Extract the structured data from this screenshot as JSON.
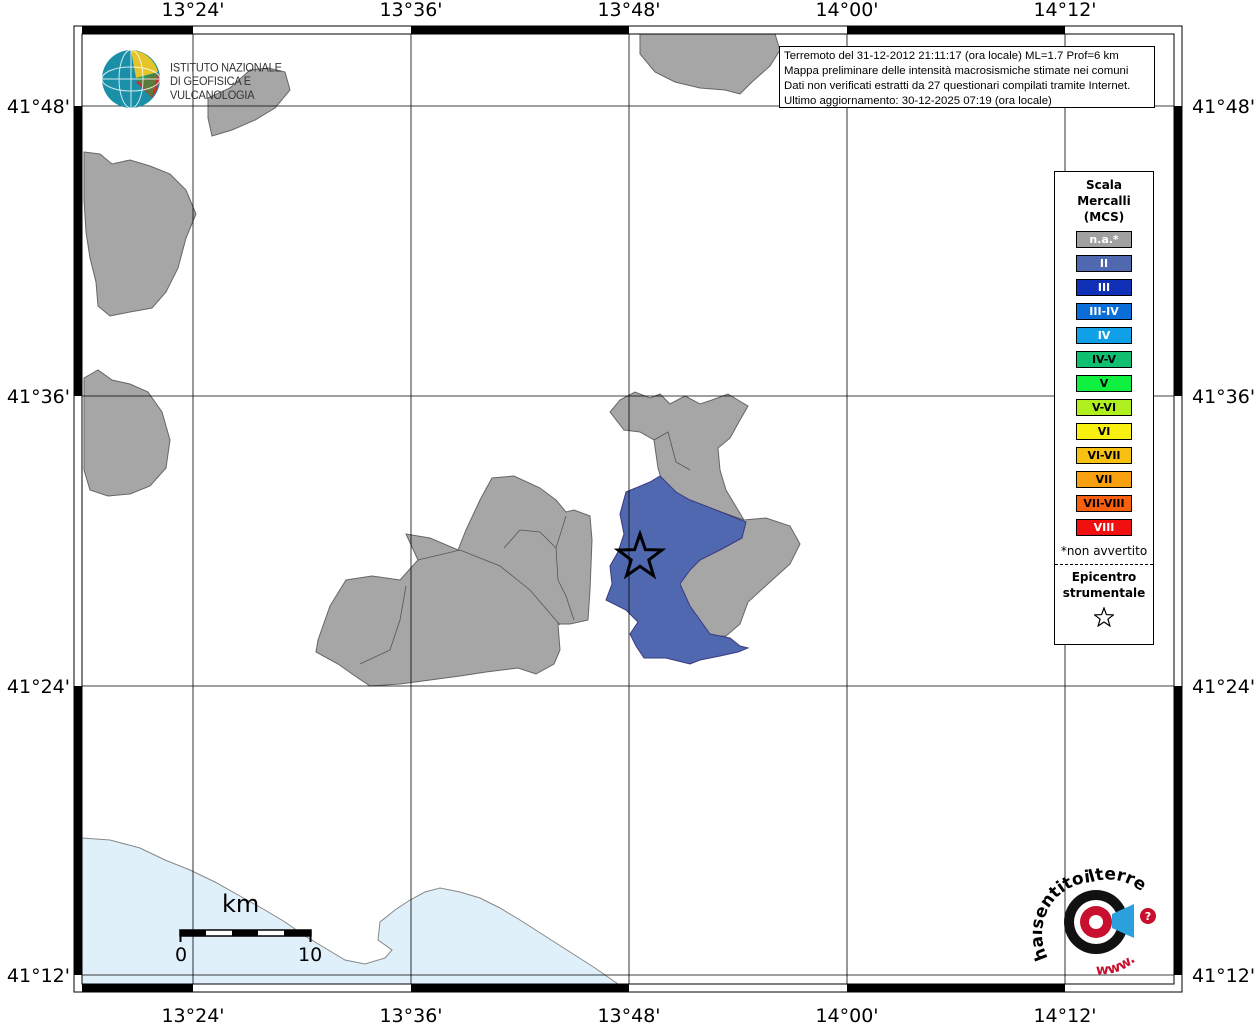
{
  "map": {
    "axes": {
      "top_lon": [
        "13°24'",
        "13°36'",
        "13°48'",
        "14°00'",
        "14°12'"
      ],
      "bottom_lon": [
        "13°24'",
        "13°36'",
        "13°48'",
        "14°00'",
        "14°12'"
      ],
      "left_lat": [
        "41°48'",
        "41°36'",
        "41°24'",
        "41°12'"
      ],
      "right_lat": [
        "41°48'",
        "41°36'",
        "41°24'",
        "41°12'"
      ]
    },
    "colors": {
      "not_felt": "#a6a6a6",
      "intensity_II": "#5068b0",
      "sea": "#e0f0fa",
      "border": "#666666"
    }
  },
  "info": {
    "line1": "Terremoto del 31-12-2012 21:11:17 (ora locale) ML=1.7 Prof=6 km",
    "line2": "Mappa preliminare delle intensità macrosismiche stimate nei comuni",
    "line3": "Dati non verificati estratti da 27 questionari compilati tramite Internet.",
    "line4": "Ultimo aggiornamento: 30-12-2025 07:19 (ora locale)"
  },
  "legend": {
    "title_line1": "Scala",
    "title_line2": "Mercalli",
    "title_line3": "(MCS)",
    "items": [
      {
        "label": "n.a.*",
        "color": "#a0a0a0",
        "text_color": "#ffffff"
      },
      {
        "label": "II",
        "color": "#5068b0",
        "text_color": "#ffffff"
      },
      {
        "label": "III",
        "color": "#1030b8",
        "text_color": "#ffffff"
      },
      {
        "label": "III-IV",
        "color": "#0a6ed8",
        "text_color": "#ffffff"
      },
      {
        "label": "IV",
        "color": "#10a0e8",
        "text_color": "#ffffff"
      },
      {
        "label": "IV-V",
        "color": "#10c070",
        "text_color": "#000000"
      },
      {
        "label": "V",
        "color": "#10f040",
        "text_color": "#000000"
      },
      {
        "label": "V-VI",
        "color": "#b0f020",
        "text_color": "#000000"
      },
      {
        "label": "VI",
        "color": "#f8f010",
        "text_color": "#000000"
      },
      {
        "label": "VI-VII",
        "color": "#f8c010",
        "text_color": "#000000"
      },
      {
        "label": "VII",
        "color": "#f8a010",
        "text_color": "#000000"
      },
      {
        "label": "VII-VIII",
        "color": "#f86010",
        "text_color": "#000000"
      },
      {
        "label": "VIII",
        "color": "#f01010",
        "text_color": "#ffffff"
      }
    ],
    "note": "*non avvertito",
    "epicentre_line1": "Epicentro",
    "epicentre_line2": "strumentale"
  },
  "logo_ingv": {
    "line1": "ISTITUTO NAZIONALE",
    "line2": "DI GEOFISICA E VULCANOLOGIA"
  },
  "scalebar": {
    "unit": "km",
    "label_start": "0",
    "label_end": "10"
  },
  "logo_hst": {
    "text": "haisentitoilterremoto.it",
    "text2": "www."
  }
}
